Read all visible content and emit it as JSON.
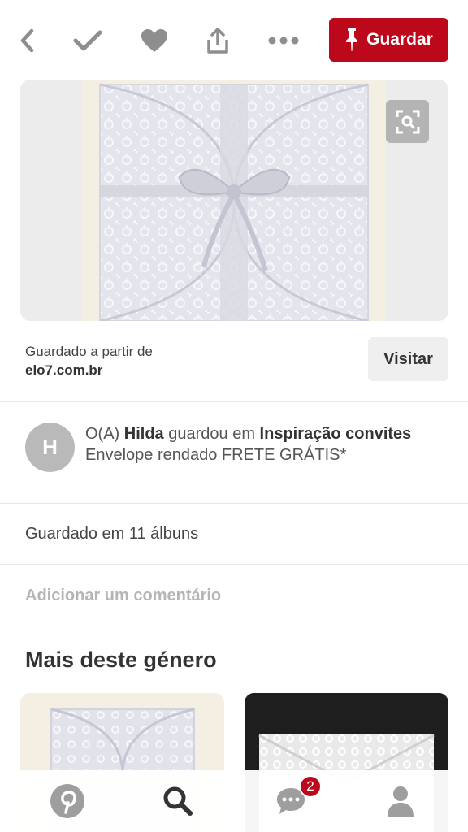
{
  "toolbar": {
    "back_icon": "chevron-left-icon",
    "done_icon": "checkmark-icon",
    "like_icon": "heart-icon",
    "share_icon": "share-icon",
    "more_icon": "ellipsis-icon",
    "save_label": "Guardar",
    "save_color": "#bd081c"
  },
  "pin": {
    "image_alt": "Envelope rendado",
    "lens_icon": "visual-search-icon",
    "source_label": "Guardado a partir de",
    "source_domain": "elo7.com.br",
    "visit_label": "Visitar"
  },
  "saved_by": {
    "avatar_initial": "H",
    "prefix": "O(A) ",
    "user": "Hilda",
    "middle": " guardou em ",
    "board": "Inspiração convites",
    "description": "Envelope rendado FRETE GRÁTIS*"
  },
  "albums_text": "Guardado em 11 álbuns",
  "comment_placeholder": "Adicionar um comentário",
  "more_title": "Mais deste género",
  "bottom_nav": {
    "home_icon": "pinterest-logo-icon",
    "search_icon": "search-icon",
    "messages_icon": "chat-bubble-icon",
    "messages_badge": "2",
    "profile_icon": "person-icon"
  }
}
